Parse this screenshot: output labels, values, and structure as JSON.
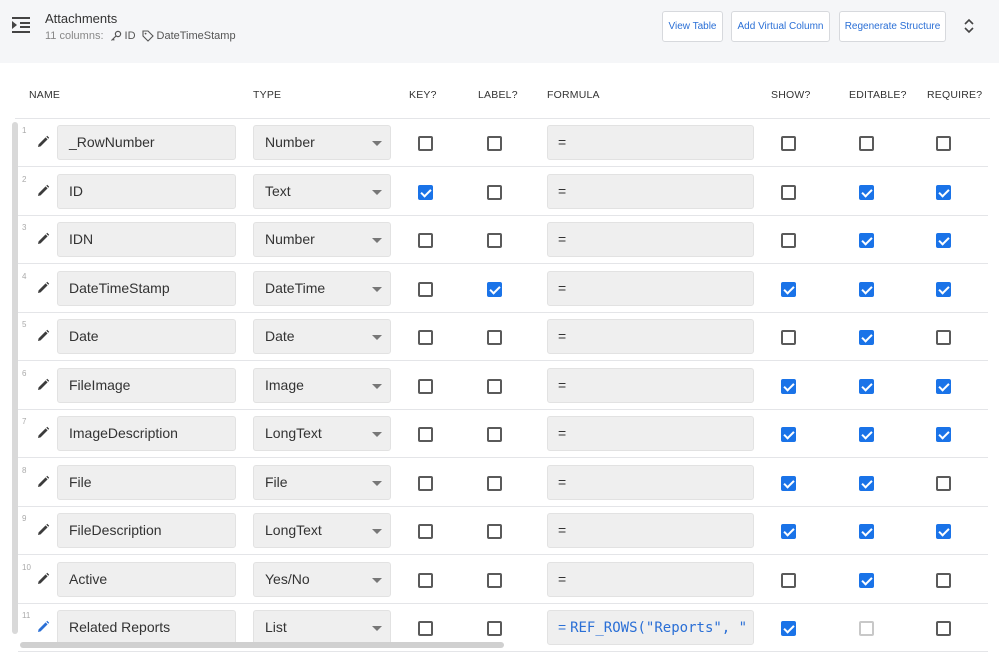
{
  "header": {
    "title": "Attachments",
    "columns_count": "11",
    "columns_label": "columns:",
    "key_chip": "ID",
    "label_chip": "DateTimeStamp",
    "buttons": {
      "view_table": "View Table",
      "add_virtual_column": "Add Virtual Column",
      "regenerate_structure": "Regenerate Structure"
    },
    "icons": [
      "menu-collapse-icon",
      "key-icon",
      "tag-icon",
      "unfold-icon"
    ]
  },
  "columns": {
    "name": "NAME",
    "type": "TYPE",
    "key": "KEY?",
    "label": "LABEL?",
    "formula": "FORMULA",
    "show": "SHOW?",
    "editable": "EDITABLE?",
    "require": "REQUIRE?"
  },
  "colors": {
    "accent": "#1a73e8",
    "link": "#2a6fd6",
    "field_bg": "#efefef",
    "header_bg": "#f5f6f8"
  },
  "rows": [
    {
      "num": "1",
      "name": "_RowNumber",
      "type": "Number",
      "key": false,
      "label": false,
      "formula": "=",
      "show": false,
      "editable": false,
      "require": false
    },
    {
      "num": "2",
      "name": "ID",
      "type": "Text",
      "key": true,
      "label": false,
      "formula": "=",
      "show": false,
      "editable": true,
      "require": true
    },
    {
      "num": "3",
      "name": "IDN",
      "type": "Number",
      "key": false,
      "label": false,
      "formula": "=",
      "show": false,
      "editable": true,
      "require": true
    },
    {
      "num": "4",
      "name": "DateTimeStamp",
      "type": "DateTime",
      "key": false,
      "label": true,
      "formula": "=",
      "show": true,
      "editable": true,
      "require": true
    },
    {
      "num": "5",
      "name": "Date",
      "type": "Date",
      "key": false,
      "label": false,
      "formula": "=",
      "show": false,
      "editable": true,
      "require": false
    },
    {
      "num": "6",
      "name": "FileImage",
      "type": "Image",
      "key": false,
      "label": false,
      "formula": "=",
      "show": true,
      "editable": true,
      "require": true
    },
    {
      "num": "7",
      "name": "ImageDescription",
      "type": "LongText",
      "key": false,
      "label": false,
      "formula": "=",
      "show": true,
      "editable": true,
      "require": true
    },
    {
      "num": "8",
      "name": "File",
      "type": "File",
      "key": false,
      "label": false,
      "formula": "=",
      "show": true,
      "editable": true,
      "require": false
    },
    {
      "num": "9",
      "name": "FileDescription",
      "type": "LongText",
      "key": false,
      "label": false,
      "formula": "=",
      "show": true,
      "editable": true,
      "require": true
    },
    {
      "num": "10",
      "name": "Active",
      "type": "Yes/No",
      "key": false,
      "label": false,
      "formula": "=",
      "show": false,
      "editable": true,
      "require": false
    },
    {
      "num": "11",
      "name": "Related Reports",
      "type": "List",
      "key": false,
      "label": false,
      "formula": "=",
      "formula_expr": "REF_ROWS(\"Reports\", \"",
      "show": true,
      "editable": false,
      "editable_disabled": true,
      "require": false
    }
  ]
}
